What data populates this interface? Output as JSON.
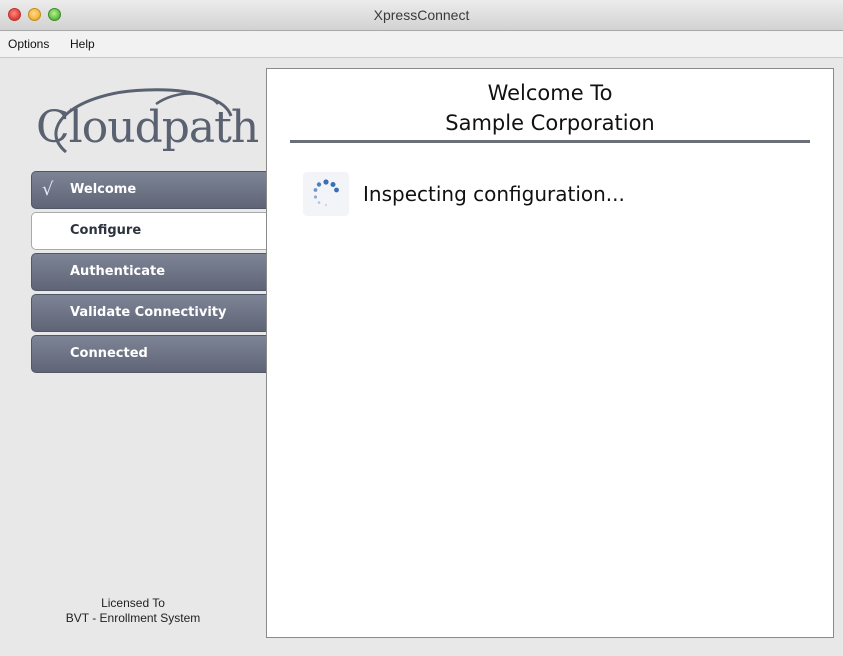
{
  "window": {
    "title": "XpressConnect"
  },
  "menu": {
    "options": "Options",
    "help": "Help"
  },
  "sidebar": {
    "logo_text": "Cloudpath",
    "steps": [
      {
        "label": "Welcome",
        "state": "completed"
      },
      {
        "label": "Configure",
        "state": "active"
      },
      {
        "label": "Authenticate",
        "state": "pending"
      },
      {
        "label": "Validate Connectivity",
        "state": "pending"
      },
      {
        "label": "Connected",
        "state": "pending"
      }
    ],
    "check_glyph": "√",
    "license_line1": "Licensed To",
    "license_line2": "BVT - Enrollment System"
  },
  "main": {
    "title_line1": "Welcome To",
    "title_line2": "Sample Corporation",
    "status": "Inspecting configuration..."
  },
  "colors": {
    "step_bg": "#6a7080",
    "rule": "#6b6f78",
    "spinner": "#3b6fb5"
  }
}
